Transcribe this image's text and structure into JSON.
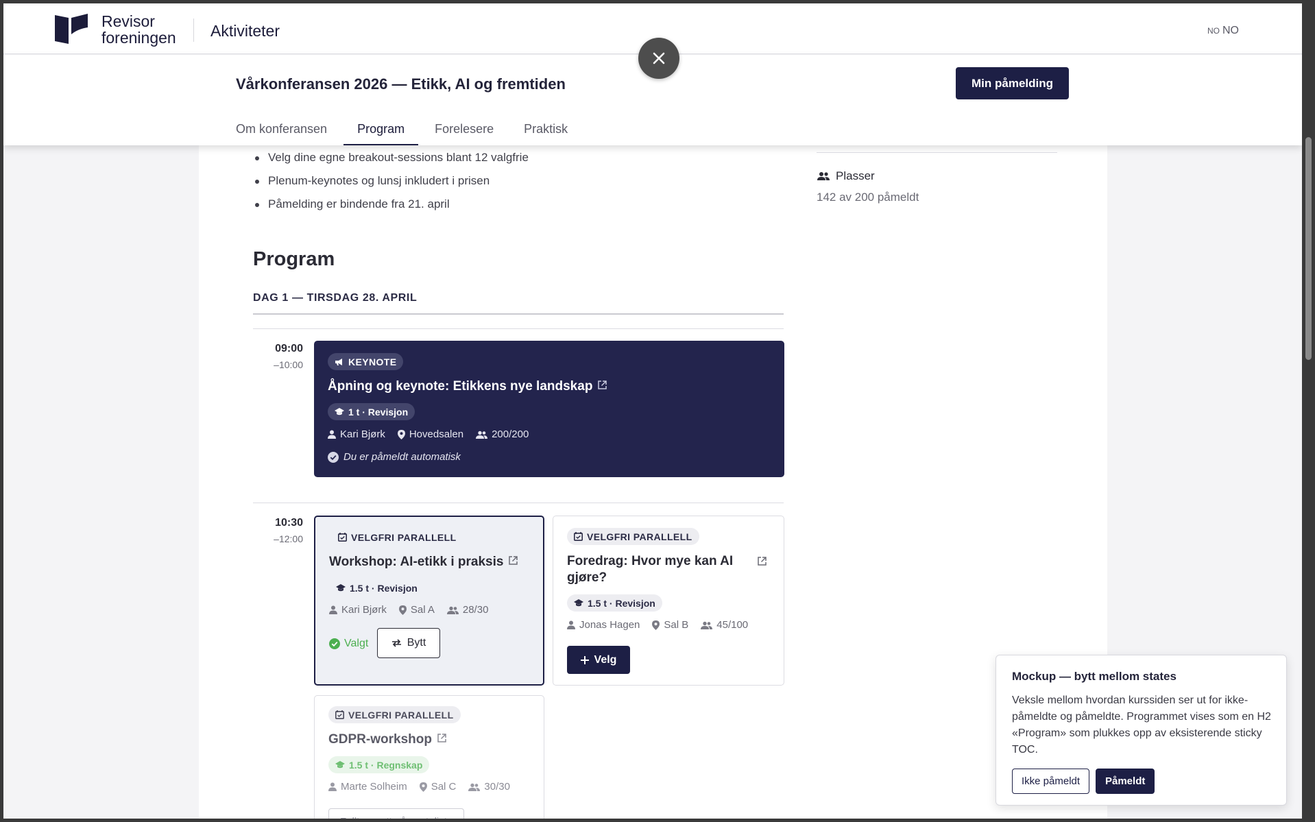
{
  "header": {
    "logo_line1": "Revisor",
    "logo_line2": "foreningen",
    "app_title": "Aktiviteter",
    "lang_small": "NO",
    "lang": "NO"
  },
  "sticky": {
    "title": "Vårkonferansen 2026 — Etikk, AI og fremtiden",
    "cta": "Min påmelding",
    "tabs": [
      "Om konferansen",
      "Program",
      "Forelesere",
      "Praktisk"
    ],
    "active_tab": "Program"
  },
  "bullets": [
    "Velg dine egne breakout-sessions blant 12 valgfrie",
    "Plenum-keynotes og lunsj inkludert i prisen",
    "Påmelding er bindende fra 21. april"
  ],
  "sidebar": {
    "places_label": "Plasser",
    "places_value": "142 av 200 påmeldt"
  },
  "program": {
    "heading": "Program",
    "day": "DAG 1 — TIRSDAG 28. APRIL",
    "slots": [
      {
        "start": "09:00",
        "end": "–10:00",
        "sessions": [
          {
            "type": "KEYNOTE",
            "title": "Åpning og keynote: Etikkens nye landskap",
            "credit": "1 t · Revisjon",
            "speaker": "Kari Bjørk",
            "room": "Hovedsalen",
            "capacity": "200/200",
            "status": "Du er påmeldt automatisk"
          }
        ]
      },
      {
        "start": "10:30",
        "end": "–12:00",
        "sessions": [
          {
            "type": "VELGFRI PARALLELL",
            "title": "Workshop: AI-etikk i praksis",
            "credit": "1.5 t · Revisjon",
            "speaker": "Kari Bjørk",
            "room": "Sal A",
            "capacity": "28/30",
            "chosen": "Valgt",
            "action": "Bytt"
          },
          {
            "type": "VELGFRI PARALLELL",
            "title": "Foredrag: Hvor mye kan AI gjøre?",
            "credit": "1.5 t · Revisjon",
            "speaker": "Jonas Hagen",
            "room": "Sal B",
            "capacity": "45/100",
            "action": "Velg"
          },
          {
            "type": "VELGFRI PARALLELL",
            "title": "GDPR-workshop",
            "credit": "1.5 t · Regnskap",
            "speaker": "Marte Solheim",
            "room": "Sal C",
            "capacity": "30/30",
            "action": "Fullt — sett på venteliste"
          }
        ]
      }
    ]
  },
  "mockup": {
    "title": "Mockup — bytt mellom states",
    "text": "Veksle mellom hvordan kurssiden ser ut for ikke-påmeldte og påmeldte. Programmet vises som en H2 «Program» som plukkes opp av eksisterende sticky TOC.",
    "btn_not_registered": "Ikke påmeldt",
    "btn_registered": "Påmeldt"
  },
  "colors": {
    "brand_navy": "#1d1f45",
    "keynote_bg": "#23244d",
    "chosen_green": "#4caf50",
    "regnskap_green": "#6fbf73"
  }
}
